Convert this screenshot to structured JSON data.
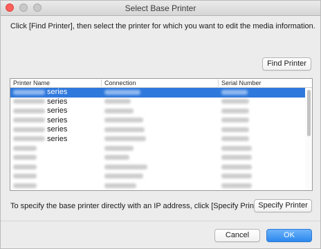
{
  "window": {
    "title": "Select Base Printer",
    "instruction": "Click [Find Printer], then select the printer for which you want to edit the media information."
  },
  "buttons": {
    "find_printer": "Find Printer",
    "specify_printer": "Specify Printer",
    "cancel": "Cancel",
    "ok": "OK"
  },
  "table": {
    "columns": [
      "Printer Name",
      "Connection",
      "Serial Number"
    ],
    "rows": [
      {
        "name_suffix": "series",
        "selected": true
      },
      {
        "name_suffix": "series",
        "selected": false
      },
      {
        "name_suffix": "series",
        "selected": false
      },
      {
        "name_suffix": "series",
        "selected": false
      },
      {
        "name_suffix": "series",
        "selected": false
      },
      {
        "name_suffix": "series",
        "selected": false
      },
      {
        "name_suffix": "",
        "selected": false
      },
      {
        "name_suffix": "",
        "selected": false
      },
      {
        "name_suffix": "",
        "selected": false
      },
      {
        "name_suffix": "",
        "selected": false
      },
      {
        "name_suffix": "",
        "selected": false
      }
    ]
  },
  "footer": {
    "specify_hint": "To specify the base printer directly with an IP address, click [Specify Printer]."
  },
  "colors": {
    "selection": "#2f78dc",
    "default_button": "#2c88ee",
    "close_light": "#fc605c"
  }
}
